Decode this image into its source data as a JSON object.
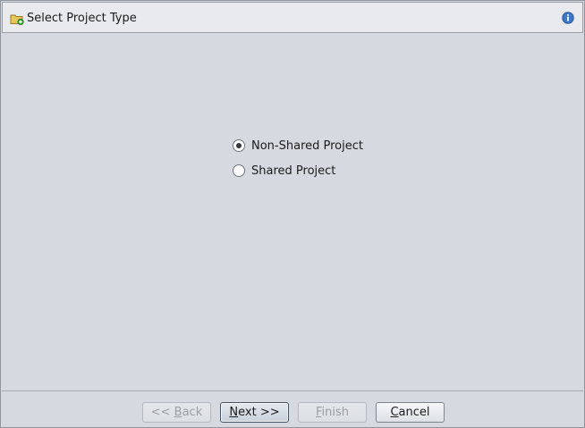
{
  "header": {
    "icon": "new-project-folder-icon",
    "title": "Select Project Type",
    "info_icon": "info-icon"
  },
  "options": [
    {
      "label": "Non-Shared Project",
      "selected": true
    },
    {
      "label": "Shared Project",
      "selected": false
    }
  ],
  "buttons": {
    "back": {
      "prefix": "<< ",
      "mnemonic": "B",
      "rest": "ack",
      "enabled": false
    },
    "next": {
      "prefix": "",
      "mnemonic": "N",
      "rest": "ext >>",
      "enabled": true
    },
    "finish": {
      "prefix": "",
      "mnemonic": "F",
      "rest": "inish",
      "enabled": false
    },
    "cancel": {
      "prefix": "",
      "mnemonic": "C",
      "rest": "ancel",
      "enabled": true
    }
  },
  "colors": {
    "background": "#d6d9df",
    "header_background": "#e8eaee",
    "disabled_text": "#9a9ea5",
    "info_blue": "#3a78c9",
    "folder_yellow": "#e8c75a",
    "plus_green": "#3aa83a"
  }
}
